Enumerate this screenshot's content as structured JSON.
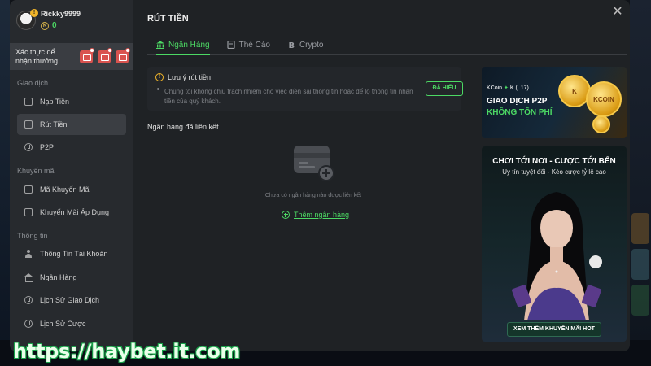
{
  "user": {
    "name": "Rickky9999",
    "balance": "0",
    "coin_symbol": "K"
  },
  "verify": {
    "label": "Xác thực để nhận thưởng"
  },
  "sidebar": {
    "sections": [
      {
        "label": "Giao dịch"
      },
      {
        "label": "Khuyến mãi"
      },
      {
        "label": "Thông tin"
      }
    ],
    "items": [
      {
        "label": "Nạp Tiền",
        "icon": "wallet-icon"
      },
      {
        "label": "Rút Tiền",
        "icon": "withdraw-icon",
        "active": true
      },
      {
        "label": "P2P",
        "icon": "p2p-icon"
      },
      {
        "label": "Mã Khuyến Mãi",
        "icon": "coupon-icon"
      },
      {
        "label": "Khuyến Mãi Áp Dụng",
        "icon": "gift-icon"
      },
      {
        "label": "Thông Tin Tài Khoản",
        "icon": "user-icon"
      },
      {
        "label": "Ngân Hàng",
        "icon": "bank-icon"
      },
      {
        "label": "Lịch Sử Giao Dịch",
        "icon": "history-icon"
      },
      {
        "label": "Lịch Sử Cược",
        "icon": "history-icon"
      }
    ]
  },
  "header": {
    "title": "RÚT TIỀN"
  },
  "tabs": [
    {
      "label": "Ngân Hàng",
      "active": true
    },
    {
      "label": "Thẻ Cào"
    },
    {
      "label": "Crypto"
    }
  ],
  "notice": {
    "title": "Lưu ý rút tiền",
    "body": "Chúng tôi không chịu trách nhiệm cho việc điền sai thông tin hoặc để lộ thông tin nhận tiền của quý khách.",
    "button": "ĐÃ HIỂU"
  },
  "linked": {
    "title": "Ngân hàng đã liên kết",
    "empty": "Chưa có ngân hàng nào được liên kết",
    "add_label": "Thêm ngân hàng"
  },
  "banner1": {
    "brand": "KCoin",
    "level": "K (L17)",
    "line1": "GIAO DỊCH P2P",
    "line2": "KHÔNG TỐN PHÍ",
    "coin1": "K",
    "coin2": "KCOIN"
  },
  "banner2": {
    "line1": "CHƠI TỚI NƠI - CƯỢC TỚI BẾN",
    "line2": "Uy tín tuyệt đối - Kèo cược tỷ lệ cao",
    "button": "XEM THÊM KHUYẾN MÃI HOT"
  },
  "watermark": "https://haybet.it.com",
  "colors": {
    "accent": "#4cd964",
    "panel": "#1f2225",
    "sidebar": "#272a2e",
    "warning": "#f0b429",
    "badge": "#d9534f"
  }
}
